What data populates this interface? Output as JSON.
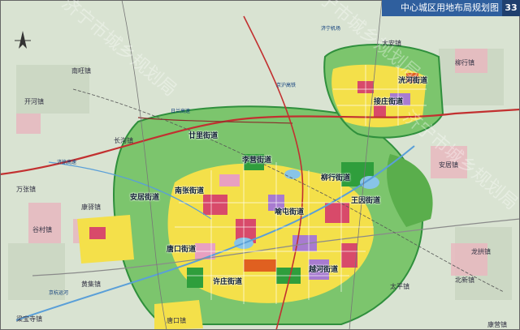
{
  "title": "中心城区用地布局规划图",
  "page_number": "33",
  "watermark": "济宁市城乡规划局",
  "districts": [
    "廿里街道",
    "南张街道",
    "安居街道",
    "李营街道",
    "喻屯街道",
    "王因街道",
    "唐口街道",
    "许庄街道",
    "柳行街道",
    "接庄街道",
    "洸河街道",
    "越河街道"
  ],
  "towns": [
    "大安镇",
    "长沟镇",
    "万张镇",
    "唐口镇",
    "柳行镇",
    "安居镇",
    "康驿镇",
    "谷村镇",
    "南旺镇",
    "开河镇",
    "梁宝寺镇",
    "康营镇",
    "龙拱镇",
    "黄集镇",
    "太平镇",
    "北新镇"
  ],
  "roads": [
    "京杭运河",
    "日兰高速",
    "京沪高铁",
    "济徐高速",
    "济宁机场"
  ],
  "colors": {
    "title_bar": "#2f5f9e",
    "page_num": "#1f3f6e",
    "residential": "#f4e04a",
    "commercial": "#d84a6a",
    "industrial": "#a87bd0",
    "green": "#4fb24f",
    "water": "#88c4e8",
    "farmland": "#c8d6c0"
  }
}
